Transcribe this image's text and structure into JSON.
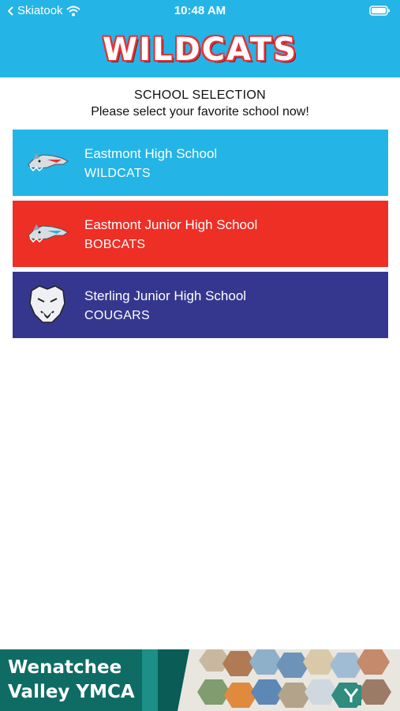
{
  "status_bar": {
    "back_label": "Skiatook",
    "time": "10:48 AM"
  },
  "header": {
    "title": "WILDCATS",
    "background": "#25b4e6",
    "title_outline": "#e53238"
  },
  "selection": {
    "title": "SCHOOL SELECTION",
    "subtitle": "Please select your favorite school now!"
  },
  "schools": [
    {
      "name": "Eastmont High School",
      "mascot": "WILDCATS",
      "color": "#25b4e6",
      "logo": "wildcat-logo-icon"
    },
    {
      "name": "Eastmont Junior High School",
      "mascot": "BOBCATS",
      "color": "#ed2f26",
      "logo": "bobcat-logo-icon"
    },
    {
      "name": "Sterling Junior High School",
      "mascot": "COUGARS",
      "color": "#35378f",
      "logo": "cougar-logo-icon"
    }
  ],
  "ad": {
    "line1": "Wenatchee",
    "line2": "Valley YMCA"
  }
}
